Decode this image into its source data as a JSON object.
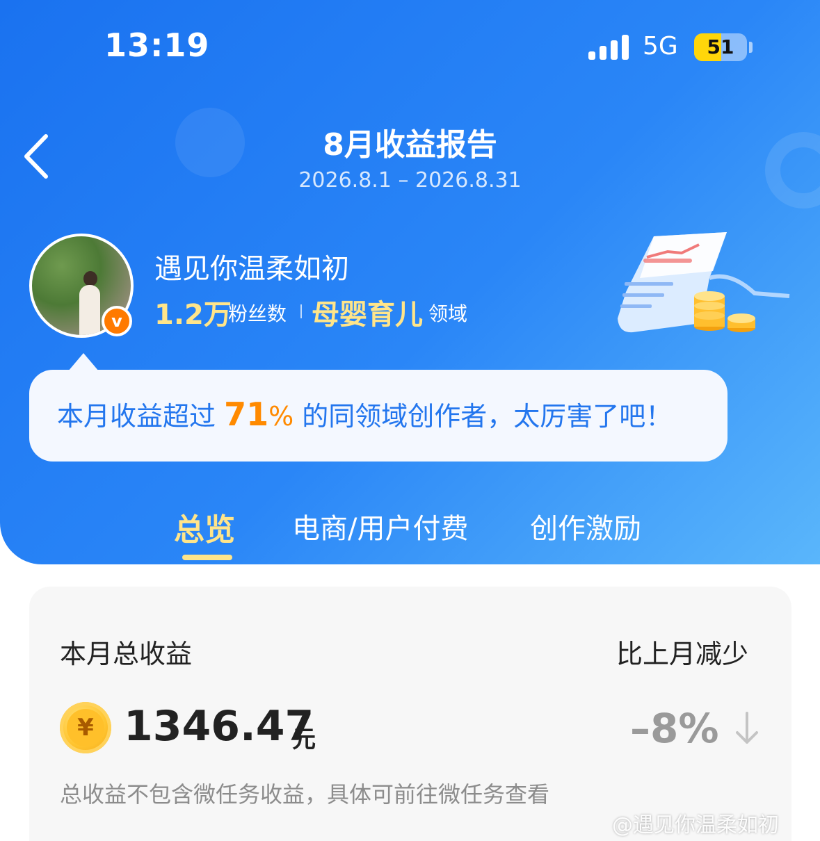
{
  "status_bar": {
    "time": "13:19",
    "network": "5G",
    "battery": "51",
    "battery_level": 0.51
  },
  "header": {
    "title": "8月收益报告",
    "date_range": "2026.8.1 – 2026.8.31"
  },
  "profile": {
    "name": "遇见你温柔如初",
    "fans_count": "1.2万",
    "fans_label": "粉丝数",
    "domain": "母婴育儿",
    "domain_suffix": "领域",
    "badge": "v"
  },
  "bubble": {
    "prefix": "本月收益超过 ",
    "percent": "71",
    "percent_sign": "%",
    "suffix": " 的同领域创作者，太厉害了吧！"
  },
  "tabs": [
    {
      "label": "总览",
      "active": true
    },
    {
      "label": "电商/用户付费",
      "active": false
    },
    {
      "label": "创作激励",
      "active": false
    }
  ],
  "summary": {
    "title": "本月总收益",
    "compare_label": "比上月减少",
    "coin_symbol": "¥",
    "amount": "1346.47",
    "unit": "元",
    "change": "–8%",
    "note": "总收益不包含微任务收益，具体可前往微任务查看"
  },
  "watermark": "@遇见你温柔如初",
  "colors": {
    "primary_blue": "#1a72f0",
    "highlight_yellow": "#ffe58a",
    "orange": "#ff8a00",
    "text_dark": "#222222",
    "text_gray": "#8c8c8c"
  }
}
